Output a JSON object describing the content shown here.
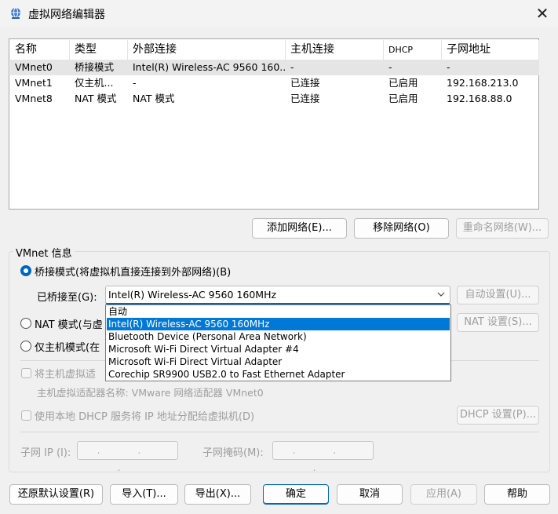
{
  "window": {
    "title": "虚拟网络编辑器",
    "close_glyph": "✕"
  },
  "table": {
    "headers": [
      "名称",
      "类型",
      "外部连接",
      "主机连接",
      "DHCP",
      "子网地址"
    ],
    "rows": [
      [
        "VMnet0",
        "桥接模式",
        "Intel(R) Wireless-AC 9560 160...",
        "-",
        "-",
        "-"
      ],
      [
        "VMnet1",
        "仅主机...",
        "-",
        "已连接",
        "已启用",
        "192.168.213.0"
      ],
      [
        "VMnet8",
        "NAT 模式",
        "NAT 模式",
        "已连接",
        "已启用",
        "192.168.88.0"
      ]
    ]
  },
  "table_buttons": {
    "add": "添加网络(E)...",
    "remove": "移除网络(O)",
    "rename": "重命名网络(W)..."
  },
  "info": {
    "group_title": "VMnet 信息",
    "bridged_label": "桥接模式(将虚拟机直接连接到外部网络)(B)",
    "bridged_to_label": "已桥接至(G):",
    "bridged_to_value": "Intel(R) Wireless-AC 9560 160MHz",
    "auto_settings": "自动设置(U)...",
    "nat_label": "NAT 模式(与虚",
    "nat_settings": "NAT 设置(S)...",
    "hostonly_label": "仅主机模式(在",
    "connect_host_label": "将主机虚拟适",
    "adapter_name": "主机虚拟适配器名称: VMware 网络适配器 VMnet0",
    "dhcp_label": "使用本地 DHCP 服务将 IP 地址分配给虚拟机(D)",
    "dhcp_settings": "DHCP 设置(P)...",
    "subnet_ip_label": "子网 IP (I):",
    "subnet_mask_label": "子网掩码(M):",
    "ip_placeholder": ". . ."
  },
  "dropdown": {
    "options": [
      "自动",
      "Intel(R) Wireless-AC 9560 160MHz",
      "Bluetooth Device (Personal Area Network)",
      "Microsoft Wi-Fi Direct Virtual Adapter #4",
      "Microsoft Wi-Fi Direct Virtual Adapter",
      "Corechip SR9900 USB2.0 to Fast Ethernet Adapter"
    ],
    "highlighted_index": 1
  },
  "footer": {
    "restore": "还原默认设置(R)",
    "import": "导入(T)...",
    "export": "导出(X)...",
    "ok": "确定",
    "cancel": "取消",
    "apply": "应用(A)",
    "help": "帮助"
  },
  "colors": {
    "accent": "#0067c0",
    "highlight": "#0078d7",
    "disabled_text": "#9e9e9e"
  }
}
